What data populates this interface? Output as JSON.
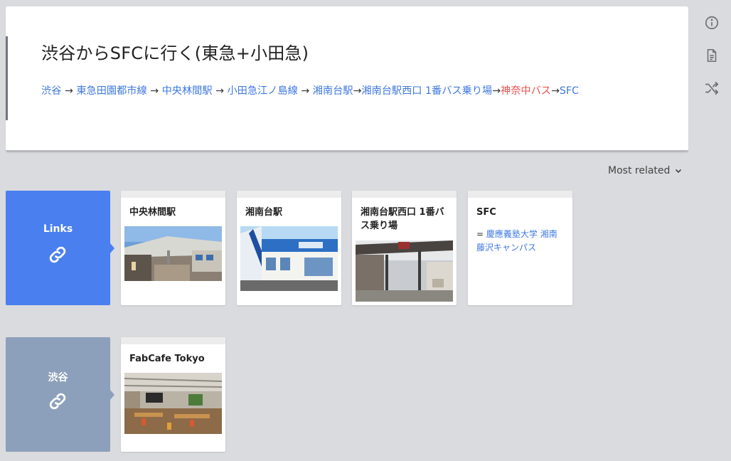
{
  "page": {
    "title": "渋谷からSFCに行く(東急+小田急)",
    "route": [
      {
        "type": "link",
        "text": "渋谷"
      },
      {
        "type": "text",
        "text": " → "
      },
      {
        "type": "link",
        "text": "東急田園都市線"
      },
      {
        "type": "text",
        "text": " → "
      },
      {
        "type": "link",
        "text": "中央林間駅"
      },
      {
        "type": "text",
        "text": " → "
      },
      {
        "type": "link",
        "text": "小田急江ノ島線"
      },
      {
        "type": "text",
        "text": " → "
      },
      {
        "type": "link",
        "text": "湘南台駅"
      },
      {
        "type": "text",
        "text": "→"
      },
      {
        "type": "link",
        "text": "湘南台駅西口 1番バス乗り場"
      },
      {
        "type": "text",
        "text": "→"
      },
      {
        "type": "link-missing",
        "text": "神奈中バス"
      },
      {
        "type": "text",
        "text": "→"
      },
      {
        "type": "link",
        "text": "SFC"
      }
    ]
  },
  "rail": {
    "icons": [
      "info-icon",
      "document-icon",
      "shuffle-icon"
    ]
  },
  "sort": {
    "label": "Most related"
  },
  "groups": {
    "links": {
      "label": "Links",
      "cards": [
        {
          "title": "中央林間駅",
          "image": "station-photo"
        },
        {
          "title": "湘南台駅",
          "image": "station-photo"
        },
        {
          "title": "湘南台駅西口 1番バス乗り場",
          "image": "bus-stop-photo"
        },
        {
          "title": "SFC",
          "desc_prefix": "= ",
          "desc_link": "慶應義塾大学 湘南藤沢キャンパス"
        }
      ]
    },
    "shibuya": {
      "label": "渋谷",
      "cards": [
        {
          "title": "FabCafe Tokyo",
          "image": "cafe-photo"
        }
      ]
    }
  },
  "colors": {
    "accent": "#4a7fef",
    "link": "#3f78e0",
    "missing_link": "#e8504e",
    "group_secondary": "#8da0bb",
    "background": "#dadbde"
  }
}
